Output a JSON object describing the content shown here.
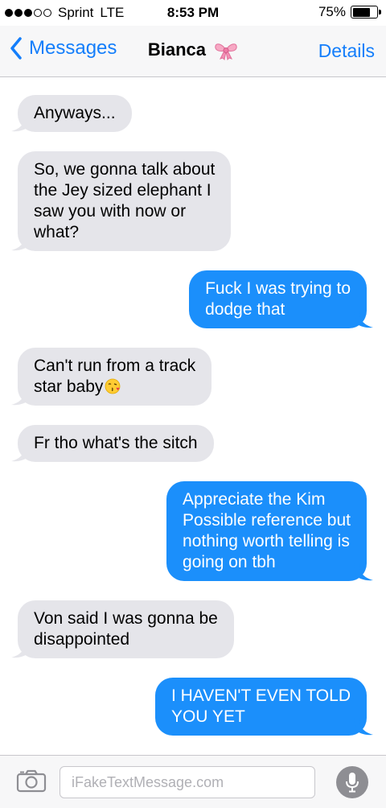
{
  "status_bar": {
    "carrier": "Sprint",
    "network": "LTE",
    "time": "8:53 PM",
    "battery": "75%",
    "battery_level": 0.75,
    "signal_bars": 3
  },
  "nav": {
    "back_label": "Messages",
    "title": "Bianca",
    "title_icon": "ribbon-bow-icon",
    "details_label": "Details",
    "accent_color": "#147efb"
  },
  "messages": [
    {
      "dir": "in",
      "text": "Anyways..."
    },
    {
      "dir": "in",
      "text": "So, we gonna talk about\nthe Jey sized elephant I\nsaw you with now or\nwhat?"
    },
    {
      "dir": "out",
      "text": "Fuck I was trying to\ndodge that"
    },
    {
      "dir": "in",
      "text": "Can't run from a track\nstar baby",
      "emoji": "face-blowing-kiss-icon"
    },
    {
      "dir": "in",
      "text": "Fr tho what's the sitch"
    },
    {
      "dir": "out",
      "text": "Appreciate the Kim\nPossible reference but\nnothing worth telling is\ngoing on tbh"
    },
    {
      "dir": "in",
      "text": "Von said I was gonna be\ndisappointed"
    },
    {
      "dir": "out",
      "text": "I HAVEN'T EVEN TOLD\nYOU YET"
    }
  ],
  "input": {
    "placeholder": "iFakeTextMessage.com",
    "value": "",
    "camera_icon": "camera-icon",
    "mic_icon": "microphone-icon"
  },
  "colors": {
    "incoming_bubble": "#e5e5ea",
    "outgoing_bubble": "#1b8ffb"
  }
}
